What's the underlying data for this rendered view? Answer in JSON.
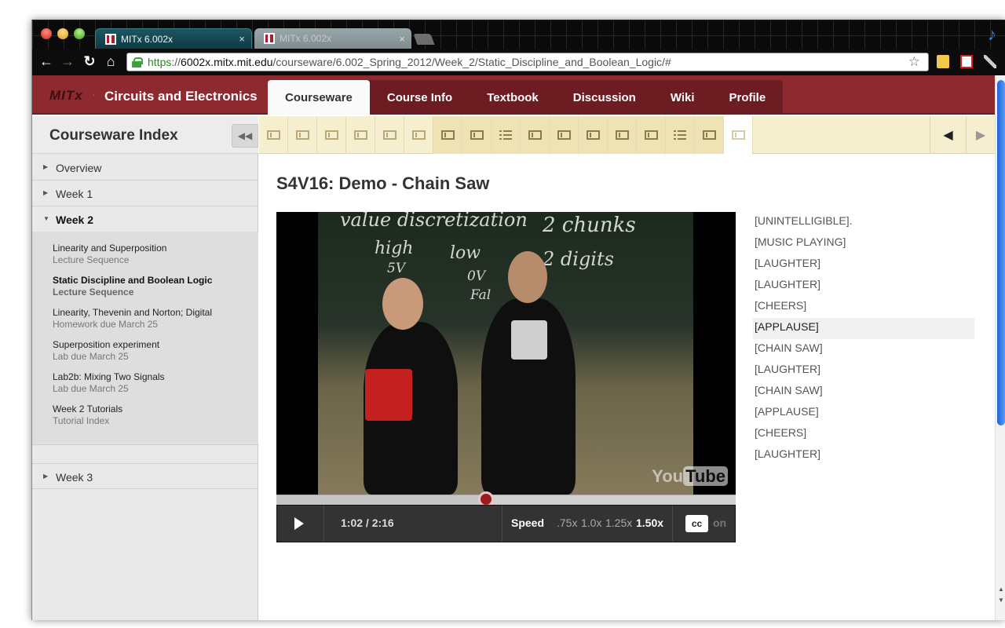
{
  "browser": {
    "tabs": [
      {
        "title": "MITx 6.002x",
        "active": true
      },
      {
        "title": "MITx 6.002x",
        "active": false
      }
    ],
    "tab_close": "×",
    "url": {
      "scheme": "https",
      "sep": "://",
      "host": "6002x.mitx.mit.edu",
      "path": "/courseware/6.002_Spring_2012/Week_2/Static_Discipline_and_Boolean_Logic/#"
    },
    "nav_glyphs": {
      "back": "←",
      "forward": "→",
      "reload": "↻",
      "home": "⌂",
      "star": "☆",
      "music": "♪"
    },
    "accent": "#3a7b88"
  },
  "site": {
    "logo": "MITx",
    "logo_sep": "·",
    "course": "Circuits and Electronics",
    "brand_color": "#8c2a2f",
    "nav": [
      "Courseware",
      "Course Info",
      "Textbook",
      "Discussion",
      "Wiki",
      "Profile"
    ],
    "active_nav": "Courseware"
  },
  "sidebar": {
    "title": "Courseware Index",
    "collapse_glyph": "◀◀",
    "chapters": [
      {
        "label": "Overview",
        "open": false
      },
      {
        "label": "Week 1",
        "open": false
      },
      {
        "label": "Week 2",
        "open": true
      },
      {
        "label": "Week 3",
        "open": false
      }
    ],
    "arrow_closed": "▶",
    "arrow_open": "▼",
    "sections": [
      {
        "title": "Linearity and Superposition",
        "sub": "Lecture Sequence",
        "active": false
      },
      {
        "title": "Static Discipline and Boolean Logic",
        "sub": "Lecture Sequence",
        "active": true
      },
      {
        "title": "Linearity, Thevenin and Norton; Digital",
        "sub": "Homework due March 25",
        "active": false
      },
      {
        "title": "Superposition experiment",
        "sub": "Lab due March 25",
        "active": false
      },
      {
        "title": "Lab2b: Mixing Two Signals",
        "sub": "Lab due March 25",
        "active": false
      },
      {
        "title": "Week 2 Tutorials",
        "sub": "Tutorial Index",
        "active": false
      }
    ]
  },
  "sequence": {
    "items": [
      {
        "icon": "film-icon",
        "visited": false
      },
      {
        "icon": "film-icon",
        "visited": false
      },
      {
        "icon": "film-icon",
        "visited": false
      },
      {
        "icon": "film-icon",
        "visited": false
      },
      {
        "icon": "film-icon",
        "visited": false
      },
      {
        "icon": "film-icon",
        "visited": false
      },
      {
        "icon": "film-icon",
        "visited": true
      },
      {
        "icon": "film-icon",
        "visited": true
      },
      {
        "icon": "list-icon",
        "visited": true
      },
      {
        "icon": "film-icon",
        "visited": true
      },
      {
        "icon": "film-icon",
        "visited": true
      },
      {
        "icon": "film-icon",
        "visited": true
      },
      {
        "icon": "film-icon",
        "visited": true
      },
      {
        "icon": "film-icon",
        "visited": true
      },
      {
        "icon": "list-icon",
        "visited": true
      },
      {
        "icon": "film-icon",
        "visited": true
      },
      {
        "icon": "film-icon",
        "visited": false,
        "active": true
      }
    ],
    "prev_glyph": "◀",
    "next_glyph": "▶"
  },
  "content": {
    "title": "S4V16: Demo - Chain Saw",
    "video": {
      "board_text": [
        "value discretization",
        "2 chunks",
        "high",
        "low",
        "2 digits",
        "5V",
        "0V",
        "Fal"
      ],
      "youtube": "You",
      "youtube_tube": "Tube",
      "progress_fraction": 0.456,
      "play_glyph": "play",
      "time": "1:02 / 2:16",
      "speed_label": "Speed",
      "speeds": [
        ".75x",
        "1.0x",
        "1.25x",
        "1.50x"
      ],
      "active_speed": "1.50x",
      "cc_label": "cc",
      "cc_state": "on"
    },
    "captions": [
      "[UNINTELLIGIBLE].",
      "[MUSIC PLAYING]",
      "[LAUGHTER]",
      "[LAUGHTER]",
      "[CHEERS]",
      "[APPLAUSE]",
      "[CHAIN SAW]",
      "[LAUGHTER]",
      "[CHAIN SAW]",
      "[APPLAUSE]",
      "[CHEERS]",
      "[LAUGHTER]"
    ],
    "current_caption_index": 5
  }
}
